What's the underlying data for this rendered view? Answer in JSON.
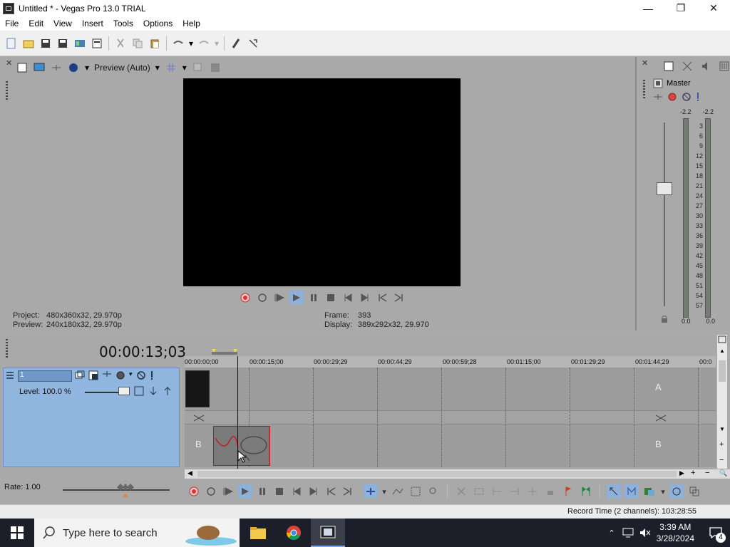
{
  "window": {
    "title": "Untitled * - Vegas Pro 13.0 TRIAL",
    "minimize": "—",
    "maximize": "❐",
    "close": "✕"
  },
  "menu": [
    "File",
    "Edit",
    "View",
    "Insert",
    "Tools",
    "Options",
    "Help"
  ],
  "preview": {
    "quality_label": "Preview (Auto)",
    "project_label": "Project:",
    "project_value": "480x360x32, 29.970p",
    "preview_label": "Preview:",
    "preview_value": "240x180x32, 29.970p",
    "frame_label": "Frame:",
    "frame_value": "393",
    "display_label": "Display:",
    "display_value": "389x292x32, 29.970"
  },
  "mixer": {
    "title": "Master",
    "peak_left": "-2.2",
    "peak_right": "-2.2",
    "scale": [
      "3",
      "6",
      "9",
      "12",
      "15",
      "18",
      "21",
      "24",
      "27",
      "30",
      "33",
      "36",
      "39",
      "42",
      "45",
      "48",
      "51",
      "54",
      "57"
    ],
    "bottom_left": "0.0",
    "bottom_right": "0.0"
  },
  "timeline": {
    "timecode": "00:00:13;03",
    "track_number": "1",
    "level": "Level: 100.0 %",
    "ruler": [
      "00:00:00;00",
      "00:00:15;00",
      "00:00:29;29",
      "00:00:44;29",
      "00:00:59;28",
      "00:01:15;00",
      "00:01:29;29",
      "00:01:44;29",
      "00:0"
    ],
    "label_a": "A",
    "label_b": "B",
    "rate": "Rate: 1.00"
  },
  "status": {
    "record_time": "Record Time (2 channels): 103:28:55"
  },
  "taskbar": {
    "search_placeholder": "Type here to search",
    "time": "3:39 AM",
    "date": "3/28/2024",
    "notifications": "4"
  },
  "colors": {
    "accent": "#90b5de",
    "panel": "#a9a9a9",
    "taskbar": "#1c1f2a"
  }
}
